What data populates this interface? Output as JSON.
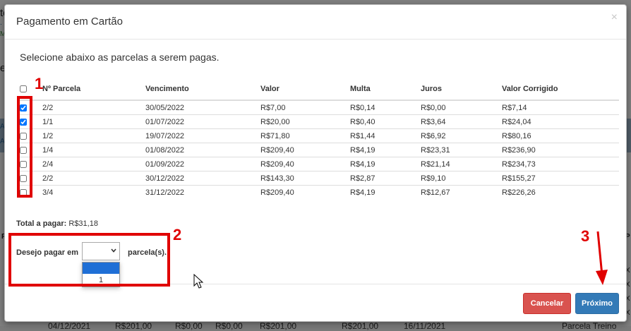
{
  "background": {
    "left_fragments": [
      "te",
      ". C",
      "Me",
      "eu",
      "A",
      "A",
      "P"
    ],
    "right_fragments": [
      "P",
      "X",
      "X",
      "X",
      "X"
    ],
    "bottom_row": [
      "04/12/2021",
      "R$201,00",
      "R$0,00",
      "R$0,00",
      "R$201,00",
      "R$201,00",
      "16/11/2021",
      "Parcela Treino"
    ]
  },
  "modal": {
    "title": "Pagamento em Cartão",
    "close_symbol": "×",
    "subtitle": "Selecione abaixo as parcelas a serem pagas.",
    "columns": [
      "Nº Parcela",
      "Vencimento",
      "Valor",
      "Multa",
      "Juros",
      "Valor Corrigido"
    ],
    "rows": [
      {
        "checked": true,
        "parcela": "2/2",
        "vencimento": "30/05/2022",
        "valor": "R$7,00",
        "multa": "R$0,14",
        "juros": "R$0,00",
        "corrigido": "R$7,14"
      },
      {
        "checked": true,
        "parcela": "1/1",
        "vencimento": "01/07/2022",
        "valor": "R$20,00",
        "multa": "R$0,40",
        "juros": "R$3,64",
        "corrigido": "R$24,04"
      },
      {
        "checked": false,
        "parcela": "1/2",
        "vencimento": "19/07/2022",
        "valor": "R$71,80",
        "multa": "R$1,44",
        "juros": "R$6,92",
        "corrigido": "R$80,16"
      },
      {
        "checked": false,
        "parcela": "1/4",
        "vencimento": "01/08/2022",
        "valor": "R$209,40",
        "multa": "R$4,19",
        "juros": "R$23,31",
        "corrigido": "R$236,90"
      },
      {
        "checked": false,
        "parcela": "2/4",
        "vencimento": "01/09/2022",
        "valor": "R$209,40",
        "multa": "R$4,19",
        "juros": "R$21,14",
        "corrigido": "R$234,73"
      },
      {
        "checked": false,
        "parcela": "2/2",
        "vencimento": "30/12/2022",
        "valor": "R$143,30",
        "multa": "R$2,87",
        "juros": "R$9,10",
        "corrigido": "R$155,27"
      },
      {
        "checked": false,
        "parcela": "3/4",
        "vencimento": "31/12/2022",
        "valor": "R$209,40",
        "multa": "R$4,19",
        "juros": "R$12,67",
        "corrigido": "R$226,26"
      }
    ],
    "total_label": "Total a pagar:",
    "total_value": "R$31,18",
    "pay_prefix": "Desejo pagar em",
    "pay_suffix": "parcela(s).",
    "select_options": [
      "",
      "1"
    ],
    "cancel_label": "Cancelar",
    "next_label": "Próximo"
  },
  "annotations": [
    "1",
    "2",
    "3"
  ],
  "colors": {
    "annotation": "#e00000",
    "cancel": "#d9534f",
    "next": "#337ab7",
    "dropdown_highlight": "#1f6fd6"
  }
}
